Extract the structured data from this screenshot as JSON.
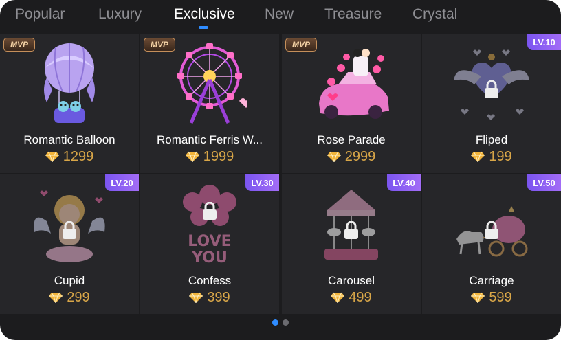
{
  "tabs": [
    {
      "label": "Popular",
      "active": false
    },
    {
      "label": "Luxury",
      "active": false
    },
    {
      "label": "Exclusive",
      "active": true
    },
    {
      "label": "New",
      "active": false
    },
    {
      "label": "Treasure",
      "active": false
    },
    {
      "label": "Crystal",
      "active": false
    }
  ],
  "gifts": [
    {
      "name": "Romantic Balloon",
      "price": "1299",
      "badge": "MVP",
      "locked": false,
      "icon": "hot-air-balloon-icon"
    },
    {
      "name": "Romantic Ferris W...",
      "price": "1999",
      "badge": "MVP",
      "locked": false,
      "icon": "ferris-wheel-icon"
    },
    {
      "name": "Rose Parade",
      "price": "2999",
      "badge": "MVP",
      "locked": false,
      "icon": "rose-car-icon"
    },
    {
      "name": "Fliped",
      "price": "199",
      "badge": "LV.10",
      "locked": true,
      "icon": "winged-heart-icon"
    },
    {
      "name": "Cupid",
      "price": "299",
      "badge": "LV.20",
      "locked": true,
      "icon": "cupid-icon"
    },
    {
      "name": "Confess",
      "price": "399",
      "badge": "LV.30",
      "locked": true,
      "icon": "love-you-balloons-icon"
    },
    {
      "name": "Carousel",
      "price": "499",
      "badge": "LV.40",
      "locked": true,
      "icon": "carousel-icon"
    },
    {
      "name": "Carriage",
      "price": "599",
      "badge": "LV.50",
      "locked": true,
      "icon": "carriage-icon"
    }
  ],
  "pagination": {
    "pages": 2,
    "current": 1
  },
  "colors": {
    "accent": "#2f8cff",
    "price": "#d8a648",
    "level_badge": "#8a5ff3",
    "mvp_badge": "#c58f5a"
  }
}
